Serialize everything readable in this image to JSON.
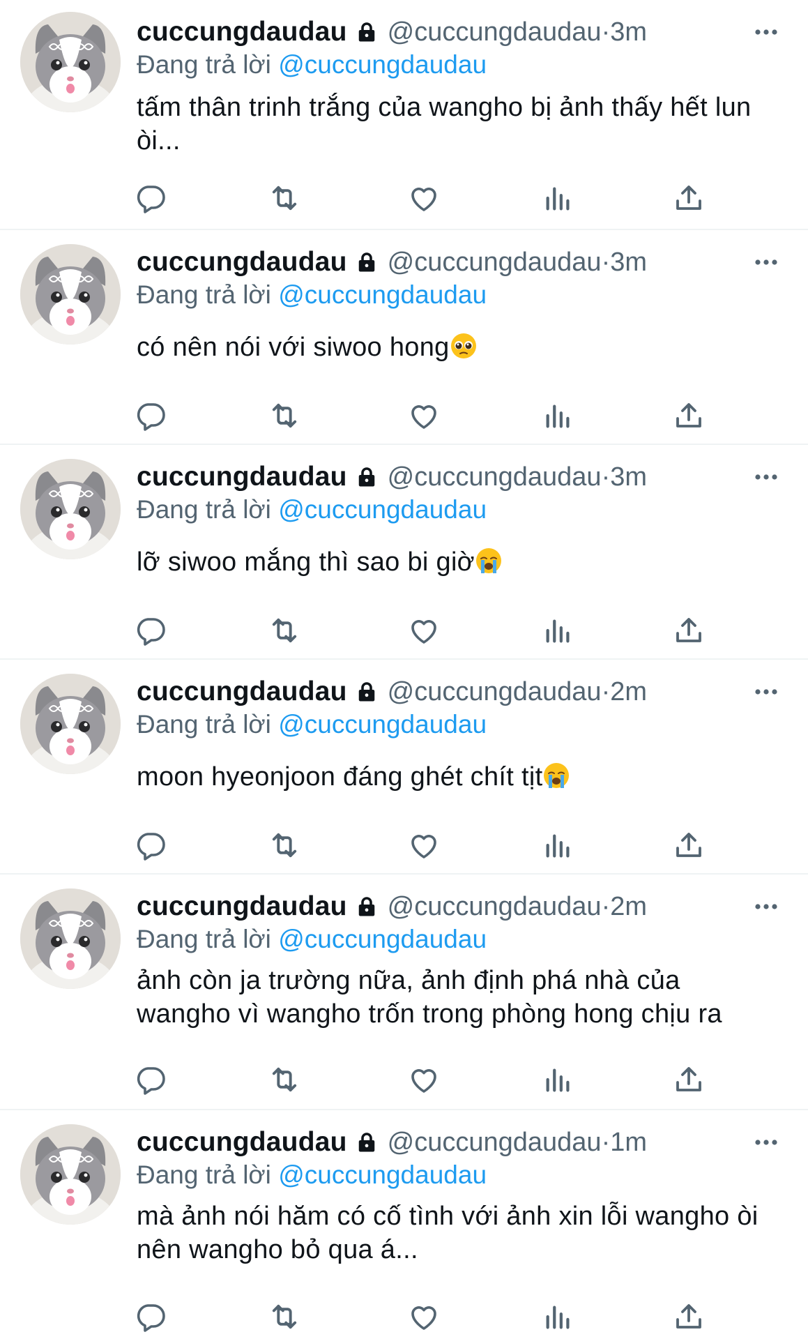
{
  "colors": {
    "text": "#0f1419",
    "muted": "#536471",
    "link": "#1d9bf0",
    "divider": "#eff3f4"
  },
  "icons": {
    "lock": "lock-icon",
    "more": "more-icon",
    "reply": "reply-icon",
    "retweet": "retweet-icon",
    "like": "like-icon",
    "views": "views-icon",
    "share": "share-icon",
    "pleading": "pleading-face-emoji",
    "crying": "loudly-crying-face-emoji"
  },
  "tweets": [
    {
      "name": "cuccungdaudau",
      "handle": "@cuccungdaudau",
      "sep": " · ",
      "time": "3m",
      "replying_prefix": "Đang trả lời ",
      "replying_to": "@cuccungdaudau",
      "text": "tấm thân trinh trắng của wangho bị ảnh thấy hết lun òi..."
    },
    {
      "name": "cuccungdaudau",
      "handle": "@cuccungdaudau",
      "sep": " · ",
      "time": "3m",
      "replying_prefix": "Đang trả lời ",
      "replying_to": "@cuccungdaudau",
      "text": "có nên nói với siwoo hong",
      "emoji": "pleading-face-emoji"
    },
    {
      "name": "cuccungdaudau",
      "handle": "@cuccungdaudau",
      "sep": " · ",
      "time": "3m",
      "replying_prefix": "Đang trả lời ",
      "replying_to": "@cuccungdaudau",
      "text": "lỡ siwoo mắng thì sao bi giờ",
      "emoji": "loudly-crying-face-emoji"
    },
    {
      "name": "cuccungdaudau",
      "handle": "@cuccungdaudau",
      "sep": " · ",
      "time": "2m",
      "replying_prefix": "Đang trả lời ",
      "replying_to": "@cuccungdaudau",
      "text": "moon hyeonjoon đáng ghét chít tịt",
      "emoji": "loudly-crying-face-emoji"
    },
    {
      "name": "cuccungdaudau",
      "handle": "@cuccungdaudau",
      "sep": " · ",
      "time": "2m",
      "replying_prefix": "Đang trả lời ",
      "replying_to": "@cuccungdaudau",
      "text": "ảnh còn ja trường nữa, ảnh định phá nhà của wangho vì wangho trốn trong phòng hong chịu ra"
    },
    {
      "name": "cuccungdaudau",
      "handle": "@cuccungdaudau",
      "sep": " · ",
      "time": "1m",
      "replying_prefix": "Đang trả lời ",
      "replying_to": "@cuccungdaudau",
      "text": "mà ảnh nói hăm có cố tình với ảnh xin lỗi wangho òi nên wangho bỏ qua á..."
    }
  ]
}
